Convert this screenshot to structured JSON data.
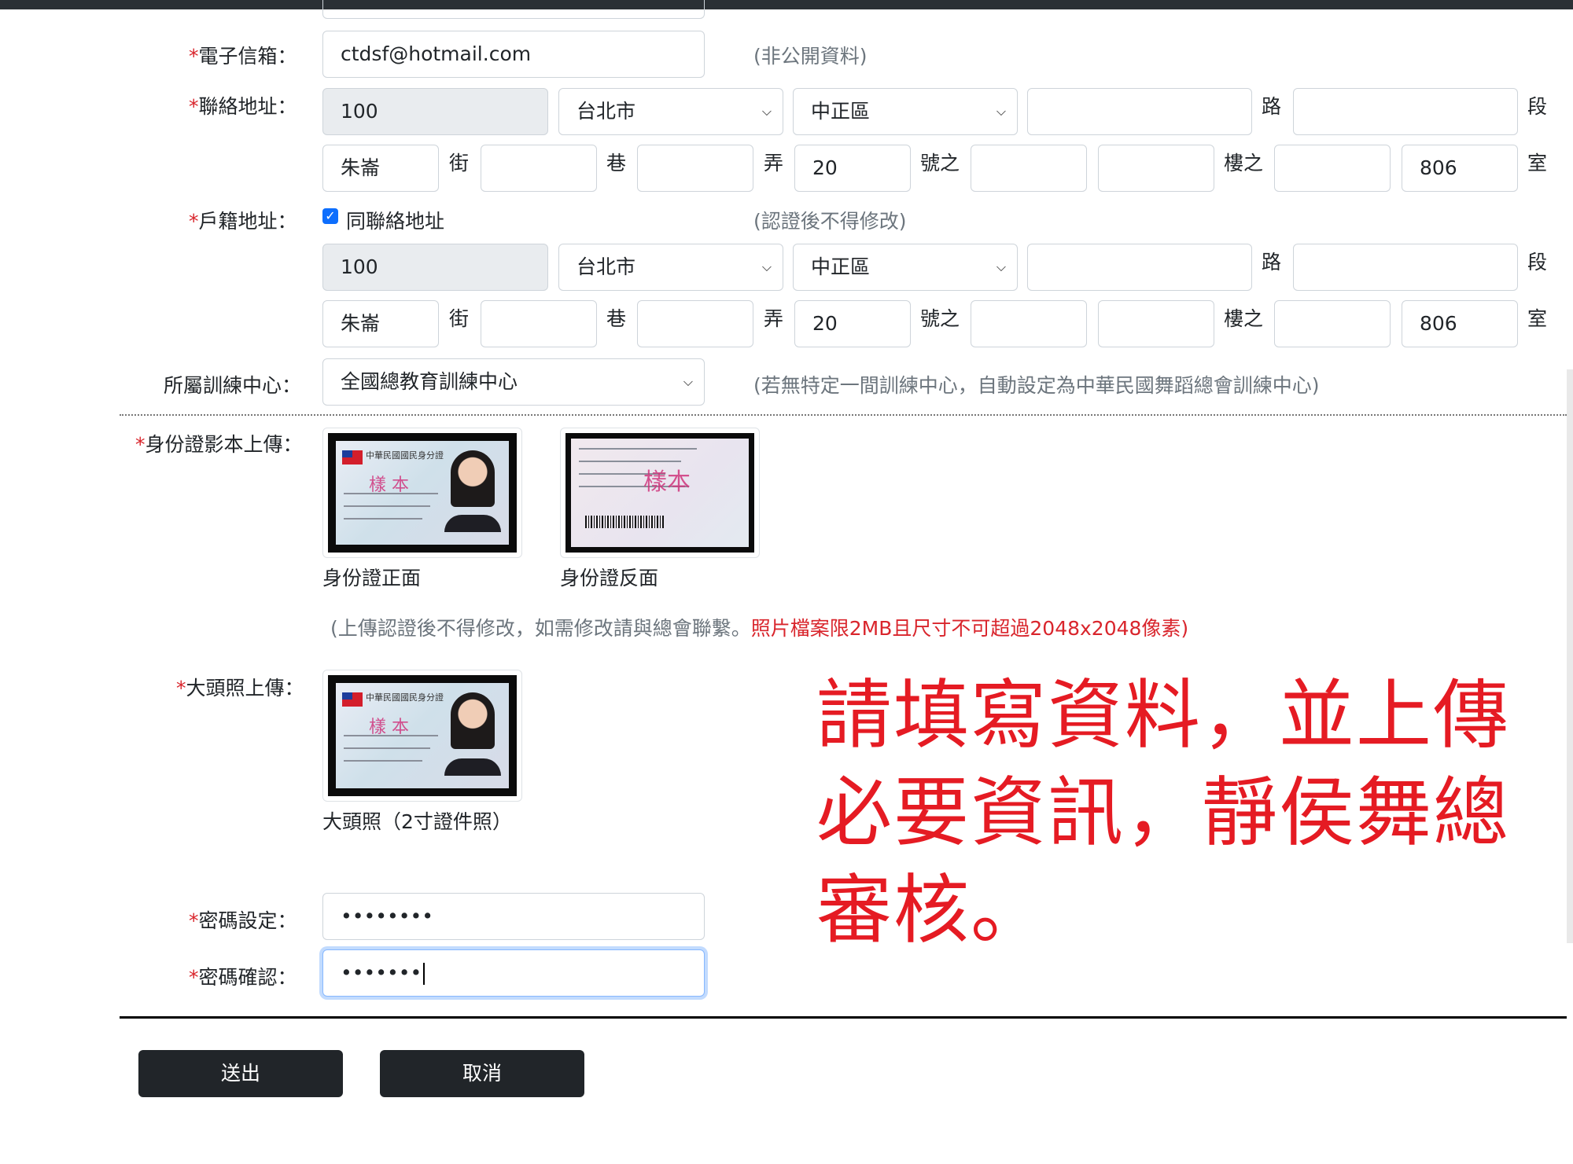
{
  "form": {
    "email": {
      "label": "電子信箱：",
      "value": "ctdsf@hotmail.com",
      "hint": "(非公開資料)"
    },
    "contact_address": {
      "label": "聯絡地址：",
      "zip": "100",
      "city": "台北市",
      "district": "中正區",
      "road_unit": "路",
      "section_unit": "段",
      "road": "朱崙",
      "street_unit": "街",
      "lane_unit": "巷",
      "alley_unit": "弄",
      "number": "20",
      "number_unit": "號之",
      "floor_unit": "樓之",
      "room": "806",
      "room_unit": "室"
    },
    "household_address": {
      "label": "戶籍地址：",
      "same_as_contact": "同聯絡地址",
      "checked": true,
      "hint": "(認證後不得修改)",
      "zip": "100",
      "city": "台北市",
      "district": "中正區",
      "road_unit": "路",
      "section_unit": "段",
      "road": "朱崙",
      "street_unit": "街",
      "lane_unit": "巷",
      "alley_unit": "弄",
      "number": "20",
      "number_unit": "號之",
      "floor_unit": "樓之",
      "room": "806",
      "room_unit": "室"
    },
    "training_center": {
      "label": "所屬訓練中心：",
      "value": "全國總教育訓練中心",
      "hint": "(若無特定一間訓練中心，自動設定為中華民國舞蹈總會訓練中心)"
    },
    "id_upload": {
      "label": "身份證影本上傳：",
      "front_caption": "身份證正面",
      "back_caption": "身份證反面",
      "front_card_title": "中華民國國民身分證",
      "stamp": "樣 本",
      "back_stamp": "樣本",
      "note": "(上傳認證後不得修改，如需修改請與總會聯繫。",
      "note_red": "照片檔案限2MB且尺寸不可超過2048x2048像素)"
    },
    "photo_upload": {
      "label": "大頭照上傳：",
      "caption": "大頭照（2寸證件照）"
    },
    "password": {
      "label": "密碼設定：",
      "value": "••••••••"
    },
    "password_confirm": {
      "label": "密碼確認：",
      "value": "•••••••"
    },
    "required_mark": "*",
    "submit_label": "送出",
    "cancel_label": "取消"
  },
  "overlay_notice": "請填寫資料，並上傳必要資訊，靜侯舞總審核。",
  "colors": {
    "required": "#d9252c",
    "button": "#212529",
    "notice": "#e51b23",
    "hint": "#6c757d"
  },
  "icons": {
    "select_arrow": "chevron-down-icon",
    "checkbox": "checkmark-icon"
  }
}
